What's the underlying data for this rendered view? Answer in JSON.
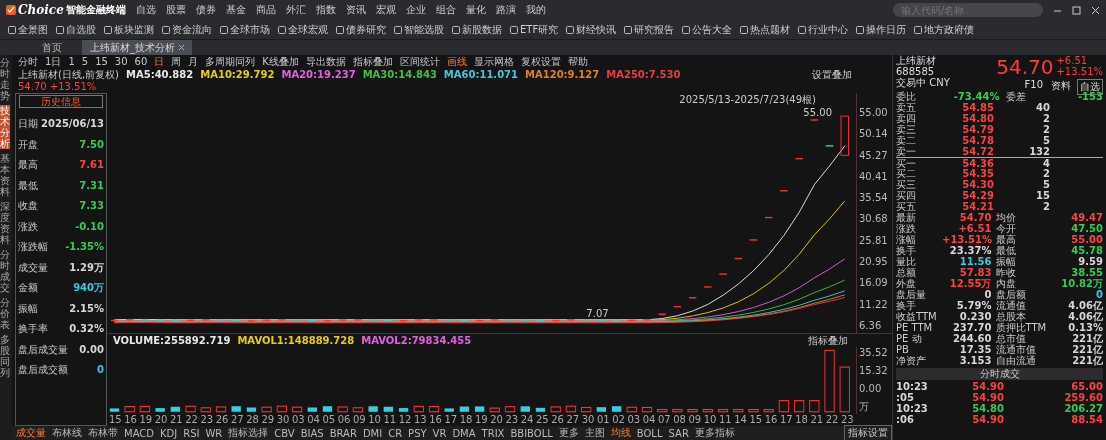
{
  "app": {
    "brand": "Choice",
    "brand_sub": "智能金融终端",
    "search": {
      "placeholder": "输入代码/名称"
    }
  },
  "menu": [
    {
      "label": "自选"
    },
    {
      "label": "股票"
    },
    {
      "label": "债券"
    },
    {
      "label": "基金"
    },
    {
      "label": "商品"
    },
    {
      "label": "外汇"
    },
    {
      "label": "指数"
    },
    {
      "label": "资讯"
    },
    {
      "label": "宏观"
    },
    {
      "label": "企业"
    },
    {
      "label": "组合"
    },
    {
      "label": "量化"
    },
    {
      "label": "路演"
    },
    {
      "label": "我的"
    }
  ],
  "toolbar": [
    "全景图",
    "自选股",
    "板块监测",
    "资金流向",
    "全球市场",
    "全球宏观",
    "债券研究",
    "智能选股",
    "新股数据",
    "ETF研究",
    "财经快讯",
    "研究报告",
    "公告大全",
    "热点题材",
    "行业中心",
    "操作日历",
    "地方政府债"
  ],
  "tabs": [
    {
      "label": "首页",
      "selected": false,
      "closable": false
    },
    {
      "label": "上纬新材_技术分析",
      "selected": true,
      "closable": true
    }
  ],
  "side_nav": [
    {
      "label": "分时走势",
      "selected": false
    },
    {
      "label": "技术分析",
      "selected": true
    },
    {
      "label": "基本资料",
      "selected": false
    },
    {
      "label": "深度资料",
      "selected": false
    },
    {
      "label": "分时成交",
      "selected": false
    },
    {
      "label": "分价表",
      "selected": false
    },
    {
      "label": "多股同列",
      "selected": false
    }
  ],
  "periods": [
    {
      "label": "分时",
      "selected": false
    },
    {
      "label": "1日",
      "selected": false
    },
    {
      "label": "1",
      "selected": false
    },
    {
      "label": "5",
      "selected": false
    },
    {
      "label": "15",
      "selected": false
    },
    {
      "label": "30",
      "selected": false
    },
    {
      "label": "60",
      "selected": false
    },
    {
      "label": "日",
      "selected": true
    },
    {
      "label": "周",
      "selected": false
    },
    {
      "label": "月",
      "selected": false
    },
    {
      "label": "多周期同列",
      "selected": false
    },
    {
      "label": "K线叠加",
      "selected": false
    },
    {
      "label": "导出数据",
      "selected": false
    },
    {
      "label": "指标叠加",
      "selected": false
    },
    {
      "label": "区间统计",
      "selected": false
    },
    {
      "label": "画线",
      "selected": true
    },
    {
      "label": "显示网格",
      "selected": false
    },
    {
      "label": "复权设置",
      "selected": false
    },
    {
      "label": "帮助",
      "selected": false
    }
  ],
  "chart": {
    "title": "上纬新材(日线,前复权)",
    "quote": "54.70 +13.51%",
    "range": "2025/5/13-2025/7/23(49根)",
    "setting": "设置叠加",
    "high_label": "55.00",
    "low_label": "7.07",
    "ma_legend": [
      {
        "text": "MA5:40.882",
        "color": "#e8e8e8"
      },
      {
        "text": "MA10:29.792",
        "color": "#e8d000"
      },
      {
        "text": "MA20:19.237",
        "color": "#e060e0"
      },
      {
        "text": "MA30:14.843",
        "color": "#40c040"
      },
      {
        "text": "MA60:11.071",
        "color": "#40c8d8"
      },
      {
        "text": "MA120:9.127",
        "color": "#e08020"
      },
      {
        "text": "MA250:7.530",
        "color": "#e04040"
      }
    ],
    "y_ticks": [
      "55.00",
      "50.14",
      "45.27",
      "40.41",
      "35.54",
      "30.68",
      "25.81",
      "20.95",
      "16.09",
      "11.22",
      "6.36"
    ],
    "vol_legend": [
      {
        "text": "VOLUME:255892.719",
        "color": "#e8e8e8"
      },
      {
        "text": "MAVOL1:148889.728",
        "color": "#e8d000"
      },
      {
        "text": "MAVOL2:79834.455",
        "color": "#e060e0"
      }
    ],
    "vol_setting": "指标叠加",
    "vol_ticks": [
      "35.52",
      "15.32",
      "0.00"
    ],
    "vol_unit": "万",
    "x_labels": [
      "15",
      "16",
      "19",
      "20",
      "21",
      "22",
      "23",
      "26",
      "27",
      "28",
      "29",
      "30",
      "03",
      "04",
      "05",
      "06",
      "09",
      "10",
      "11",
      "12",
      "13",
      "16",
      "17",
      "18",
      "19",
      "20",
      "23",
      "24",
      "25",
      "26",
      "27",
      "30",
      "01",
      "02",
      "03",
      "04",
      "07",
      "08",
      "09",
      "10",
      "11",
      "14",
      "15",
      "16",
      "17",
      "18",
      "21",
      "22",
      "23"
    ]
  },
  "info_panel": {
    "title": "历史信息",
    "rows": [
      {
        "label": "日期",
        "value": "2025/06/13",
        "color": "#d8d8d8"
      },
      {
        "label": "开盘",
        "value": "7.50",
        "color": "#33cc55"
      },
      {
        "label": "最高",
        "value": "7.61",
        "color": "#ff4040"
      },
      {
        "label": "最低",
        "value": "7.31",
        "color": "#33cc55"
      },
      {
        "label": "收盘",
        "value": "7.33",
        "color": "#33cc55"
      },
      {
        "label": "涨跌",
        "value": "-0.10",
        "color": "#33cc55"
      },
      {
        "label": "涨跌幅",
        "value": "-1.35%",
        "color": "#33cc55"
      },
      {
        "label": "成交量",
        "value": "1.29万",
        "color": "#d8d8d8"
      },
      {
        "label": "金额",
        "value": "940万",
        "color": "#38c8e0"
      },
      {
        "label": "振幅",
        "value": "2.15%",
        "color": "#d8d8d8"
      },
      {
        "label": "换手率",
        "value": "0.32%",
        "color": "#d8d8d8"
      },
      {
        "label": "盘后成交量",
        "value": "0.00",
        "color": "#d8d8d8"
      },
      {
        "label": "盘后成交额",
        "value": "0",
        "color": "#38c8e0"
      }
    ]
  },
  "indicators": [
    {
      "label": "成交量",
      "selected": true
    },
    {
      "label": "布林线",
      "selected": false
    },
    {
      "label": "布林带",
      "selected": false
    },
    {
      "label": "MACD",
      "selected": false
    },
    {
      "label": "KDJ",
      "selected": false
    },
    {
      "label": "RSI",
      "selected": false
    },
    {
      "label": "WR",
      "selected": false
    },
    {
      "label": "指标选择",
      "selected": false
    },
    {
      "label": "CBV",
      "selected": false
    },
    {
      "label": "BIAS",
      "selected": false
    },
    {
      "label": "BRAR",
      "selected": false
    },
    {
      "label": "DMI",
      "selected": false
    },
    {
      "label": "CR",
      "selected": false
    },
    {
      "label": "PSY",
      "selected": false
    },
    {
      "label": "VR",
      "selected": false
    },
    {
      "label": "DMA",
      "selected": false
    },
    {
      "label": "TRIX",
      "selected": false
    },
    {
      "label": "BBIBOLL",
      "selected": false
    },
    {
      "label": "更多",
      "selected": false
    },
    {
      "label": "主图",
      "selected": false
    },
    {
      "label": "均线",
      "selected": true
    },
    {
      "label": "BOLL",
      "selected": false
    },
    {
      "label": "SAR",
      "selected": false
    },
    {
      "label": "更多指标",
      "selected": false
    }
  ],
  "bottom_right": "指标设置",
  "quote_panel": {
    "name": "上纬新材",
    "code": "688585",
    "currency": "交易中 CNY",
    "price": "54.70",
    "change": "+6.51",
    "change_pct": "+13.51%",
    "controls": [
      "F10",
      "资料"
    ],
    "watch": "自选",
    "ratio": {
      "label": "委比",
      "value": "-73.44%",
      "label2": "委差",
      "value2": "-153"
    },
    "asks": [
      {
        "label": "卖五",
        "price": "54.85",
        "volume": "40"
      },
      {
        "label": "卖四",
        "price": "54.80",
        "volume": "2"
      },
      {
        "label": "卖三",
        "price": "54.79",
        "volume": "2"
      },
      {
        "label": "卖二",
        "price": "54.78",
        "volume": "5"
      },
      {
        "label": "卖一",
        "price": "54.72",
        "volume": "132"
      }
    ],
    "bids": [
      {
        "label": "买一",
        "price": "54.36",
        "volume": "4"
      },
      {
        "label": "买二",
        "price": "54.35",
        "volume": "2"
      },
      {
        "label": "买三",
        "price": "54.30",
        "volume": "5"
      },
      {
        "label": "买四",
        "price": "54.29",
        "volume": "15"
      },
      {
        "label": "买五",
        "price": "54.21",
        "volume": "2"
      }
    ],
    "stats": [
      {
        "left": {
          "label": "最新",
          "value": "54.70",
          "color": "#ff4040"
        },
        "right": {
          "label": "均价",
          "value": "49.47",
          "color": "#ff4040"
        }
      },
      {
        "left": {
          "label": "涨跌",
          "value": "+6.51",
          "color": "#ff4040"
        },
        "right": {
          "label": "今开",
          "value": "47.50",
          "color": "#33cc55"
        }
      },
      {
        "left": {
          "label": "涨幅",
          "value": "+13.51%",
          "color": "#ff4040"
        },
        "right": {
          "label": "最高",
          "value": "55.00",
          "color": "#ff4040"
        }
      },
      {
        "left": {
          "label": "换手",
          "value": "23.37%",
          "color": "#d8d8d8"
        },
        "right": {
          "label": "最低",
          "value": "45.78",
          "color": "#33cc55"
        }
      },
      {
        "left": {
          "label": "量比",
          "value": "11.56",
          "color": "#38c8e0"
        },
        "right": {
          "label": "振幅",
          "value": "9.59",
          "color": "#d8d8d8"
        }
      },
      {
        "left": {
          "label": "总额",
          "value": "57.83",
          "color": "#ff4040"
        },
        "right": {
          "label": "昨收",
          "value": "38.55",
          "color": "#33cc55"
        }
      },
      {
        "left": {
          "label": "外盘",
          "value": "12.55万",
          "color": "#ff4040"
        },
        "right": {
          "label": "内盘",
          "value": "10.82万",
          "color": "#33cc55"
        }
      },
      {
        "left": {
          "label": "盘后量",
          "value": "0",
          "color": "#d8d8d8"
        },
        "right": {
          "label": "盘后额",
          "value": "0",
          "color": "#38c8e0"
        }
      },
      {
        "left": {
          "label": "换手",
          "value": "5.79%",
          "color": "#d8d8d8"
        },
        "right": {
          "label": "流通值",
          "value": "4.06亿",
          "color": "#d8d8d8"
        }
      },
      {
        "left": {
          "label": "收益TTM",
          "value": "0.230",
          "color": "#d8d8d8"
        },
        "right": {
          "label": "总股本",
          "value": "4.06亿",
          "color": "#d8d8d8"
        }
      },
      {
        "left": {
          "label": "PE TTM",
          "value": "237.70",
          "color": "#d8d8d8"
        },
        "right": {
          "label": "质押比TTM",
          "value": "0.13%",
          "color": "#d8d8d8"
        }
      },
      {
        "left": {
          "label": "PE 动",
          "value": "244.60",
          "color": "#d8d8d8"
        },
        "right": {
          "label": "总市值",
          "value": "221亿",
          "color": "#d8d8d8"
        }
      },
      {
        "left": {
          "label": "PB",
          "value": "17.35",
          "color": "#d8d8d8"
        },
        "right": {
          "label": "流通市值",
          "value": "221亿",
          "color": "#d8d8d8"
        }
      },
      {
        "left": {
          "label": "净资产",
          "value": "3.153",
          "color": "#d8d8d8"
        },
        "right": {
          "label": "自由流通",
          "value": "221亿",
          "color": "#d8d8d8"
        }
      }
    ],
    "trades_title": "分时成交",
    "trades": [
      {
        "time": "10:23",
        "price": "54.90",
        "volume": "65.00",
        "color": "#ff4040"
      },
      {
        "time": ":05",
        "price": "54.90",
        "volume": "259.60",
        "color": "#ff4040"
      },
      {
        "time": "10:23",
        "price": "54.80",
        "volume": "206.27",
        "color": "#33cc55"
      },
      {
        "time": ":06",
        "price": "54.90",
        "volume": "88.54",
        "color": "#ff4040"
      }
    ]
  }
}
